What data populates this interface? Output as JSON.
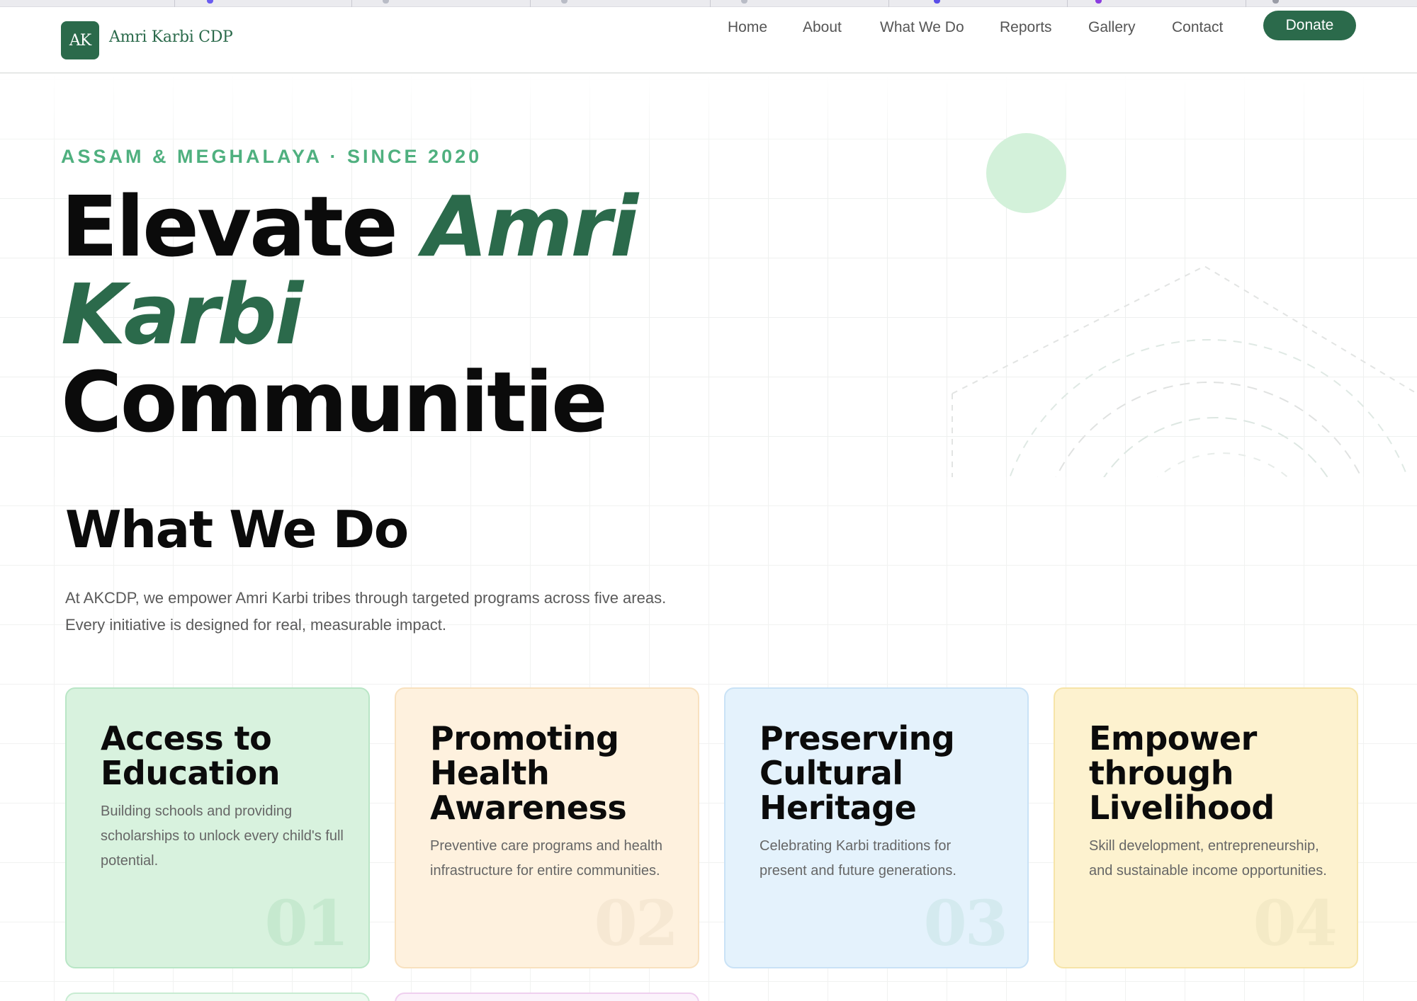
{
  "colors": {
    "brand_green": "#2b6a4b",
    "eyebrow_green": "#4fb07f",
    "card1_bg": "#d8f2de",
    "card2_bg": "#fef1de",
    "card3_bg": "#e4f2fc",
    "card4_bg": "#fdf2cf"
  },
  "header": {
    "logo_initials": "AK",
    "brand_name": "Amri Karbi CDP",
    "nav": [
      "Home",
      "About",
      "What We Do",
      "Reports",
      "Gallery",
      "Contact"
    ],
    "donate_label": "Donate"
  },
  "hero": {
    "eyebrow": "ASSAM & MEGHALAYA · SINCE 2020",
    "headline_part1": "Elevate ",
    "headline_em1": "Amri",
    "headline_em2": "Karbi",
    "headline_part2": "Communitie"
  },
  "what_we_do": {
    "title": "What We Do",
    "description_line1": "At AKCDP, we empower Amri Karbi tribes through targeted programs across five areas.",
    "description_line2": "Every initiative is designed for real, measurable impact.",
    "cards": [
      {
        "title": "Access to Education",
        "text": "Building schools and providing scholarships to unlock every child's full potential.",
        "number": "01"
      },
      {
        "title": "Promoting Health Awareness",
        "text": "Preventive care programs and health infrastructure for entire communities.",
        "number": "02"
      },
      {
        "title": "Preserving Cultural Heritage",
        "text": "Celebrating Karbi traditions for present and future generations.",
        "number": "03"
      },
      {
        "title": "Empower through Livelihood",
        "text": "Skill development, entrepreneurship, and sustainable income opportunities.",
        "number": "04"
      }
    ]
  }
}
